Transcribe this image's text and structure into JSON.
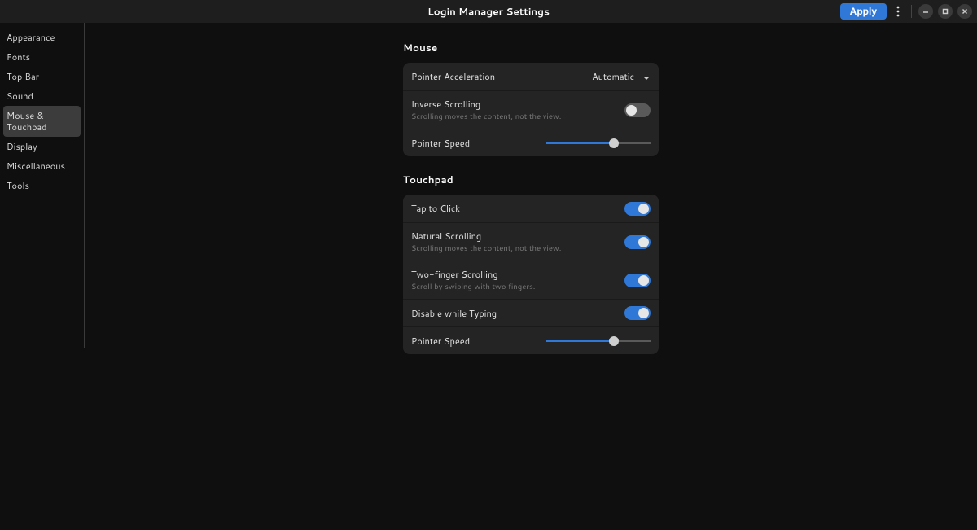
{
  "header": {
    "title": "Login Manager Settings",
    "apply_label": "Apply"
  },
  "sidebar": {
    "items": [
      {
        "label": "Appearance"
      },
      {
        "label": "Fonts"
      },
      {
        "label": "Top Bar"
      },
      {
        "label": "Sound"
      },
      {
        "label": "Mouse & Touchpad"
      },
      {
        "label": "Display"
      },
      {
        "label": "Miscellaneous"
      },
      {
        "label": "Tools"
      }
    ],
    "active_index": 4
  },
  "mouse": {
    "section_title": "Mouse",
    "pointer_accel_label": "Pointer Acceleration",
    "pointer_accel_value": "Automatic",
    "inverse_scroll_label": "Inverse Scrolling",
    "inverse_scroll_sub": "Scrolling moves the content, not the view.",
    "inverse_scroll_on": false,
    "pointer_speed_label": "Pointer Speed",
    "pointer_speed_pct": 65
  },
  "touchpad": {
    "section_title": "Touchpad",
    "tap_to_click_label": "Tap to Click",
    "tap_to_click_on": true,
    "natural_scroll_label": "Natural Scrolling",
    "natural_scroll_sub": "Scrolling moves the content, not the view.",
    "natural_scroll_on": true,
    "two_finger_label": "Two-finger Scrolling",
    "two_finger_sub": "Scroll by swiping with two fingers.",
    "two_finger_on": true,
    "disable_typing_label": "Disable while Typing",
    "disable_typing_on": true,
    "pointer_speed_label": "Pointer Speed",
    "pointer_speed_pct": 65
  },
  "colors": {
    "accent": "#2f78d8"
  }
}
